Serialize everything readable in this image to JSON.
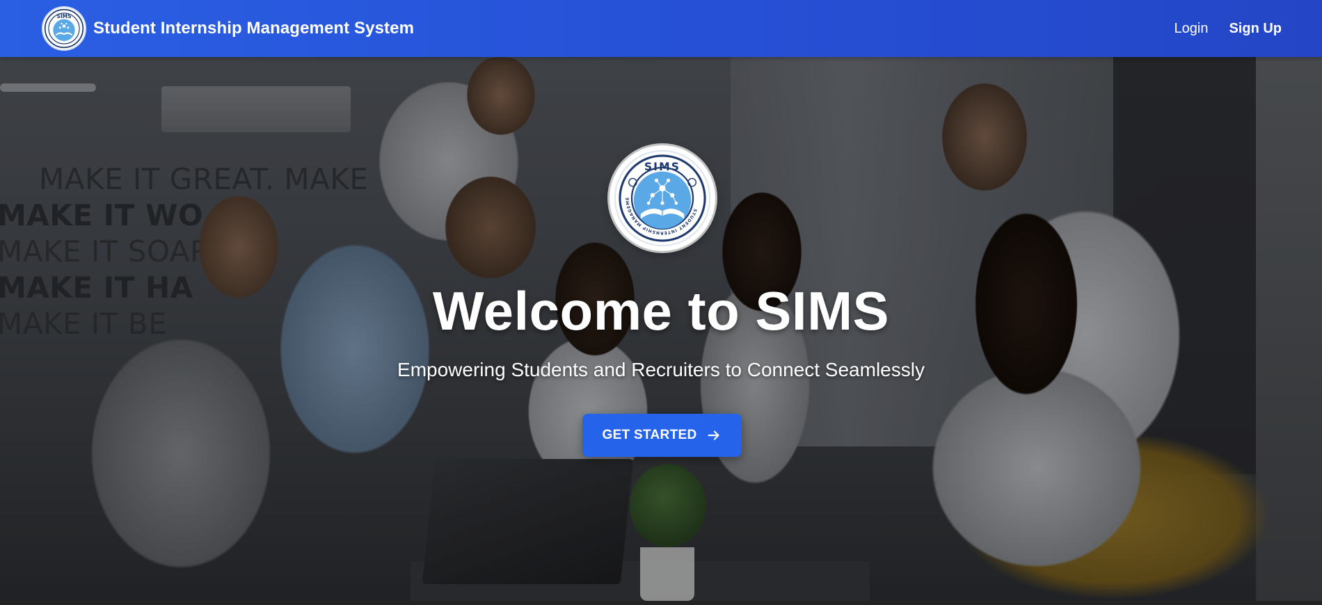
{
  "navbar": {
    "title": "Student Internship Management System",
    "logo_icon": "sims-logo-icon",
    "links": [
      {
        "label": "Login",
        "bold": false
      },
      {
        "label": "Sign Up",
        "bold": true
      }
    ],
    "background_color": "#2a5fe3"
  },
  "logo": {
    "ring_text": "SIMS",
    "ring_subtext": "STUDENT INTERNSHIP MANAGEMENT SYSTEM",
    "inner_color": "#5aa8e6",
    "ring_color": "#1e3a6e"
  },
  "background": {
    "wall_text": [
      "MAKE IT GREAT. MAKE",
      "MAKE IT WO",
      "MAKE IT SOAR",
      "MAKE IT HA",
      "MAKE IT BE"
    ]
  },
  "hero": {
    "title": "Welcome to SIMS",
    "subtitle": "Empowering Students and Recruiters to Connect Seamlessly",
    "cta_label": "GET STARTED",
    "cta_icon": "arrow-right-icon",
    "cta_color": "#2563eb"
  }
}
